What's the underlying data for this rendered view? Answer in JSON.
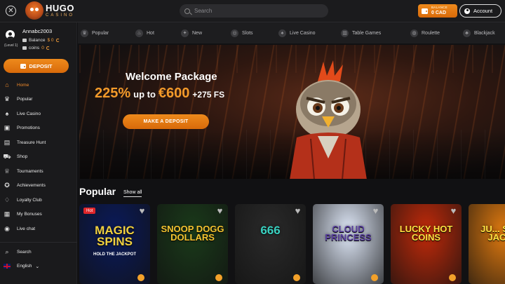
{
  "topbar": {
    "close_icon": "close-icon",
    "logo": {
      "line1": "HUGO",
      "line2": "CASINO"
    },
    "search_placeholder": "Search",
    "balance": {
      "label": "BALANCE",
      "value": "0 CAD"
    },
    "account_label": "Account"
  },
  "sidebar": {
    "username": "Annabc2003",
    "level": "(Level 1)",
    "balance_label": "Balance",
    "balance_value": "$ 0",
    "coins_label": "coins",
    "coins_value": "0",
    "deposit_label": "DEPOSIT",
    "items": [
      {
        "label": "Home",
        "icon": "home-icon",
        "active": true
      },
      {
        "label": "Popular",
        "icon": "crown-icon"
      },
      {
        "label": "Live Casino",
        "icon": "cards-icon"
      },
      {
        "label": "Promotions",
        "icon": "promotions-icon"
      },
      {
        "label": "Treasure Hunt",
        "icon": "treasure-icon"
      },
      {
        "label": "Shop",
        "icon": "cart-icon"
      },
      {
        "label": "Tournaments",
        "icon": "trophy-icon"
      },
      {
        "label": "Achievements",
        "icon": "achievement-icon"
      },
      {
        "label": "Loyalty Club",
        "icon": "loyalty-icon"
      },
      {
        "label": "My Bonuses",
        "icon": "gift-icon"
      },
      {
        "label": "Live chat",
        "icon": "chat-icon"
      }
    ],
    "search_label": "Search",
    "language_label": "English"
  },
  "categories": [
    {
      "label": "Popular",
      "icon": "crown-icon"
    },
    {
      "label": "Hot",
      "icon": "fire-icon"
    },
    {
      "label": "New",
      "icon": "new-icon"
    },
    {
      "label": "Slots",
      "icon": "slots-icon"
    },
    {
      "label": "Live Casino",
      "icon": "cards-icon"
    },
    {
      "label": "Table Games",
      "icon": "table-games-icon"
    },
    {
      "label": "Roulette",
      "icon": "roulette-icon"
    },
    {
      "label": "Blackjack",
      "icon": "blackjack-icon"
    }
  ],
  "banner": {
    "title": "Welcome Package",
    "percent": "225%",
    "upto": "up to",
    "amount": "€600",
    "extra": "+275 FS",
    "cta": "MAKE A DEPOSIT"
  },
  "popular": {
    "title": "Popular",
    "show_all": "Show all",
    "games": [
      {
        "name": "MAGIC SPINS",
        "sub": "HOLD THE JACKPOT",
        "tag": "Hot",
        "bg": "#0a1a5a",
        "color": "#f0d040"
      },
      {
        "name": "SNOOP DOGG DOLLARS",
        "sub": "",
        "tag": "",
        "bg": "#1a3a1a",
        "color": "#f4c430"
      },
      {
        "name": "666",
        "sub": "",
        "tag": "",
        "bg": "#2a2a2a",
        "color": "#3ad0c0"
      },
      {
        "name": "CLOUD PRINCESS",
        "sub": "",
        "tag": "",
        "bg": "#dfe8f8",
        "color": "#5a40a0"
      },
      {
        "name": "LUCKY HOT COINS",
        "sub": "",
        "tag": "",
        "bg": "#c02a0a",
        "color": "#ffe040"
      },
      {
        "name": "JU... SEV... JACK...",
        "sub": "",
        "tag": "",
        "bg": "#e07a10",
        "color": "#ffe040"
      }
    ]
  }
}
